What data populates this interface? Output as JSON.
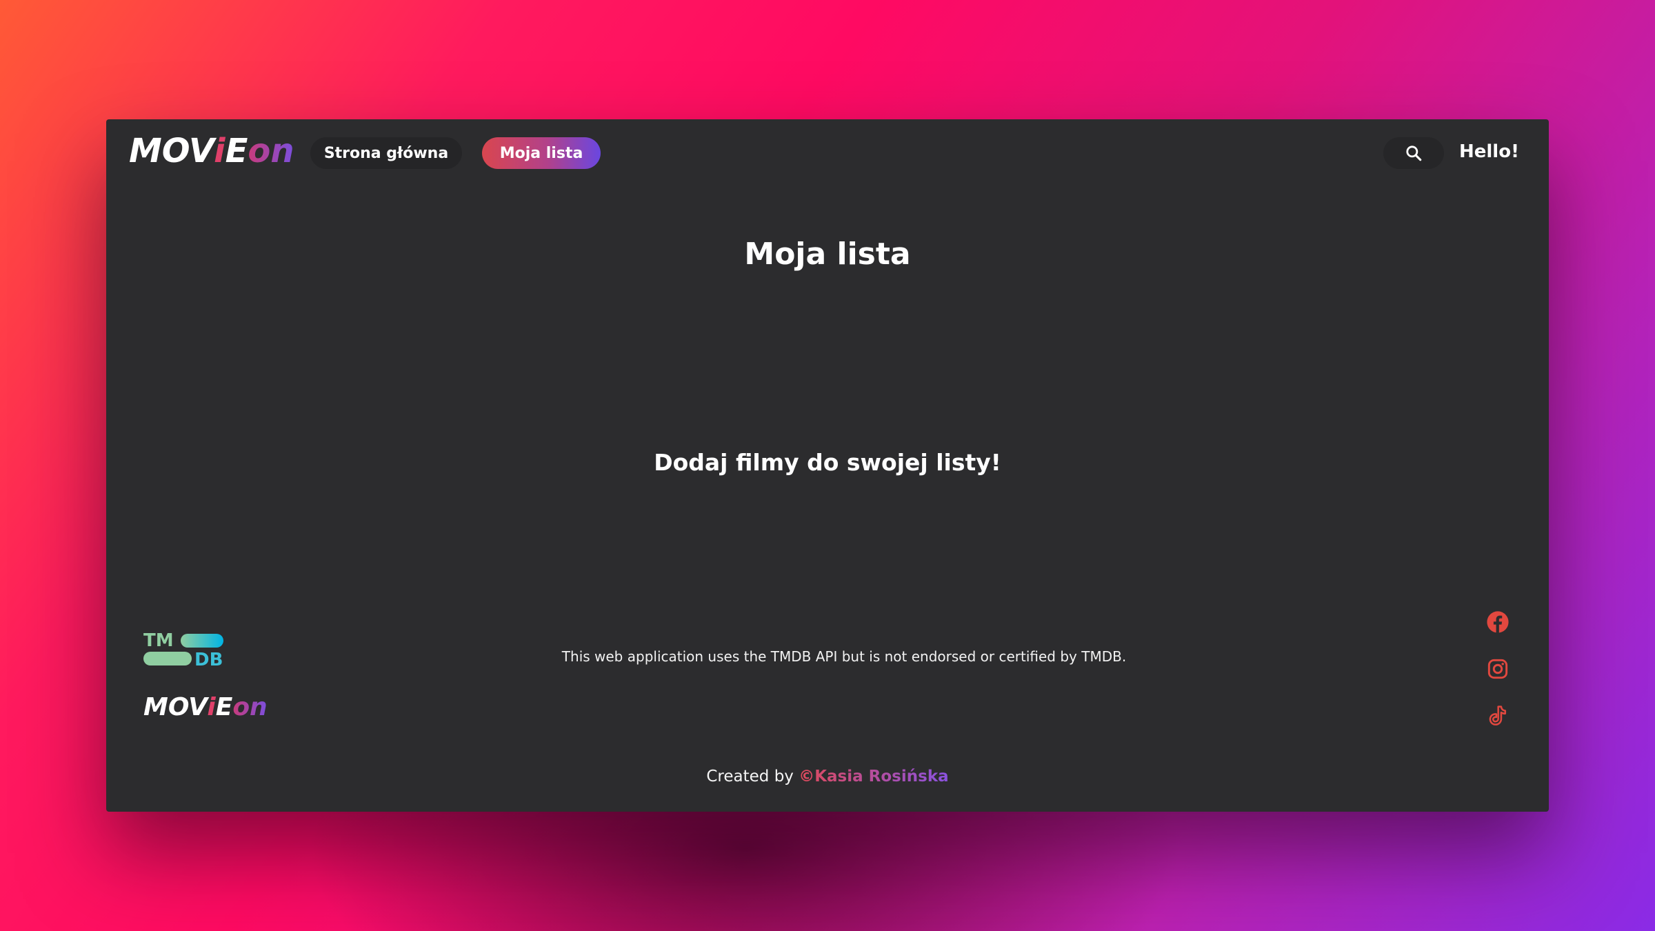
{
  "header": {
    "logo": {
      "part1": "MOV",
      "part2": "i",
      "part3": "E",
      "part4": "on"
    },
    "nav": {
      "home_label": "Strona główna",
      "list_label": "Moja lista"
    },
    "search_icon": "search-icon",
    "greeting": "Hello!"
  },
  "main": {
    "title": "Moja lista",
    "empty_message": "Dodaj filmy do swojej listy!"
  },
  "footer": {
    "tmdb_logo": {
      "top": "TM",
      "bottom": "DB"
    },
    "logo": {
      "part1": "MOV",
      "part2": "i",
      "part3": "E",
      "part4": "on"
    },
    "disclaimer": "This web application uses the TMDB API but is not endorsed or certified by TMDB.",
    "social_icons": [
      "facebook-icon",
      "instagram-icon",
      "tiktok-icon"
    ],
    "credits_prefix": "Created by",
    "credits_author": "©Kasia Rosińska"
  },
  "colors": {
    "window_bg": "#2c2c2e",
    "accent_red": "#e0415a",
    "accent_purple": "#6a47e0",
    "social_icon": "#e2483f",
    "tmdb_green": "#90cea1",
    "tmdb_blue": "#01b4e4"
  }
}
